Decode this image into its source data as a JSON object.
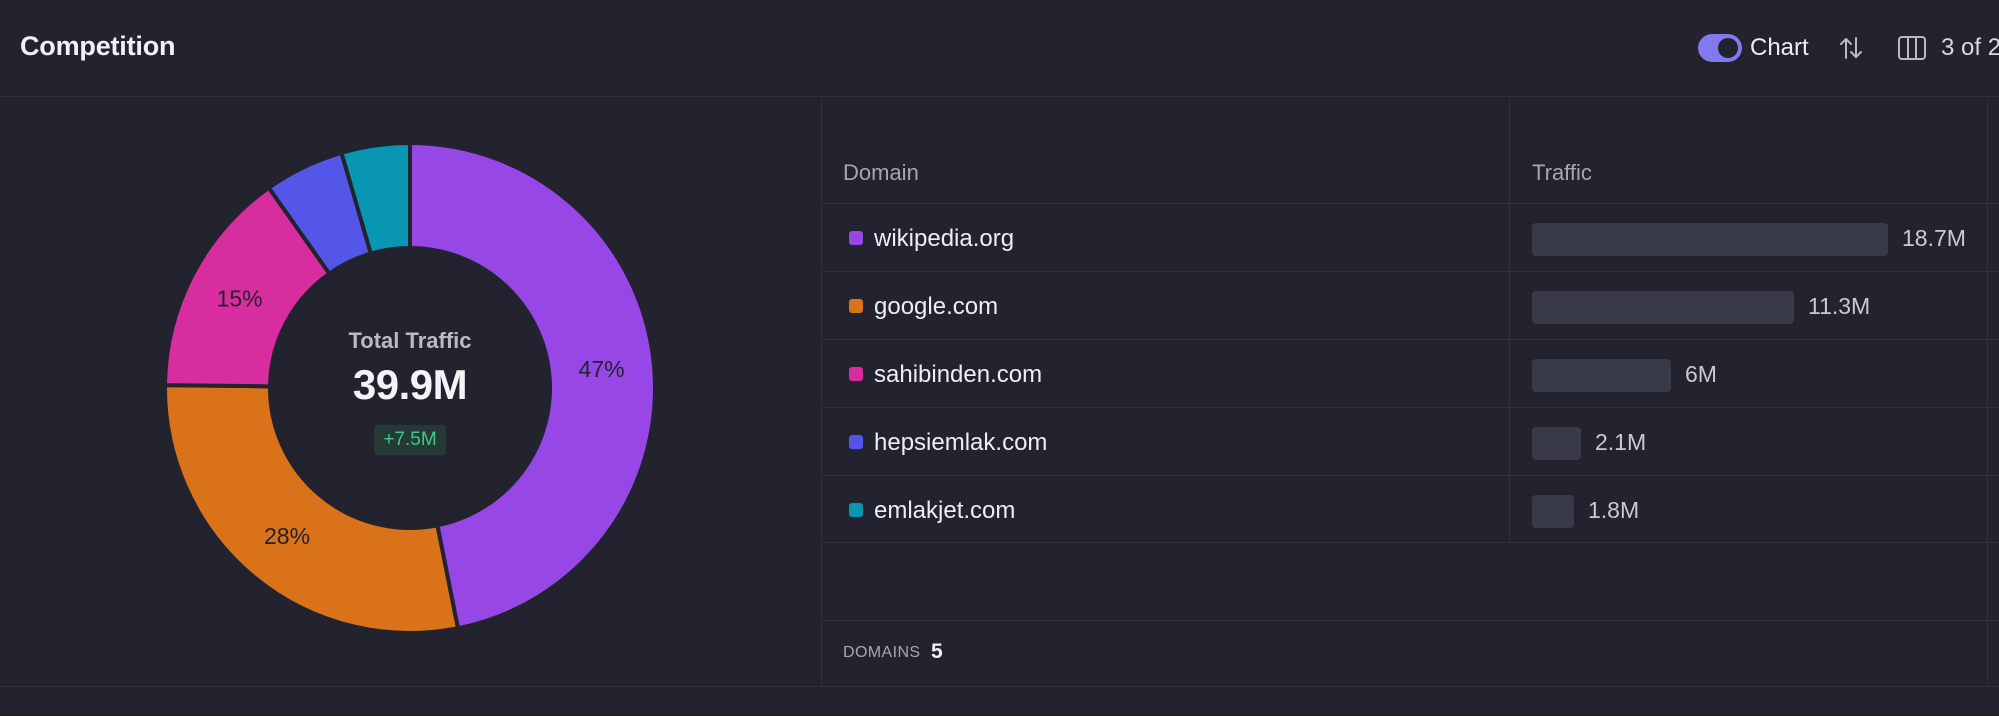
{
  "header": {
    "title": "Competition",
    "chart_toggle_label": "Chart",
    "columns_count": "3 of 2"
  },
  "summary": {
    "title": "Total Traffic",
    "value": "39.9M",
    "delta": "+7.5M"
  },
  "table": {
    "columns": [
      "Domain",
      "Traffic"
    ],
    "rows": [
      {
        "domain": "wikipedia.org",
        "traffic": "18.7M",
        "color": "#9747e6"
      },
      {
        "domain": "google.com",
        "traffic": "11.3M",
        "color": "#d97218"
      },
      {
        "domain": "sahibinden.com",
        "traffic": "6M",
        "color": "#d82d9f"
      },
      {
        "domain": "hepsiemlak.com",
        "traffic": "2.1M",
        "color": "#5456e8"
      },
      {
        "domain": "emlakjet.com",
        "traffic": "1.8M",
        "color": "#0896b2"
      }
    ],
    "footer_label": "DOMAINS",
    "footer_count": "5"
  },
  "chart_data": {
    "type": "pie",
    "categories": [
      "wikipedia.org",
      "google.com",
      "sahibinden.com",
      "hepsiemlak.com",
      "emlakjet.com"
    ],
    "values": [
      18.7,
      11.3,
      6,
      2.1,
      1.8
    ],
    "labels": [
      "47%",
      "28%",
      "15%",
      "",
      ""
    ],
    "colors": [
      "#9747e6",
      "#d97218",
      "#d82d9f",
      "#5456e8",
      "#0896b2"
    ]
  }
}
